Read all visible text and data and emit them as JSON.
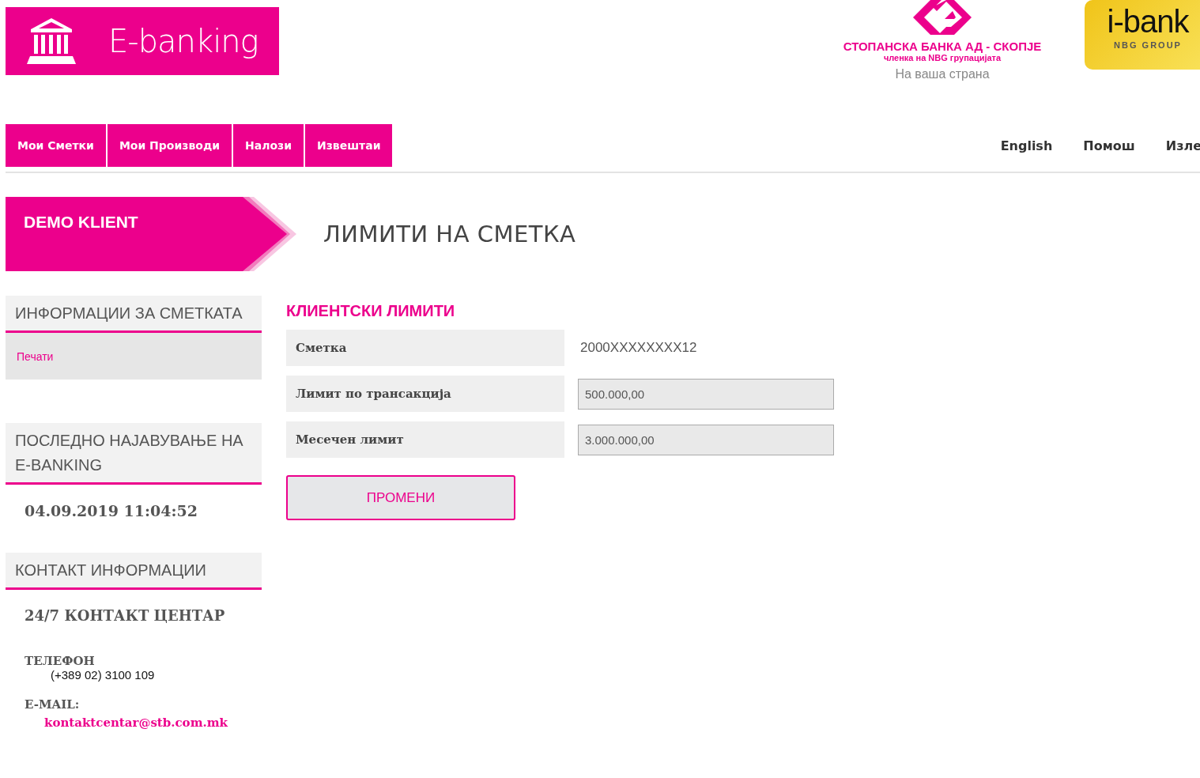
{
  "header": {
    "logo_text": "E-banking",
    "bank_name": "СТОПАНСКА БАНКА АД - СКОПЈЕ",
    "bank_member": "членка на NBG групацијата",
    "bank_slogan": "На ваша страна",
    "ibank_name": "i-bank",
    "ibank_group": "NBG GROUP"
  },
  "nav": [
    "Мои Сметки",
    "Мои Производи",
    "Налози",
    "Извештаи"
  ],
  "top_links": [
    "English",
    "Помош",
    "Изле"
  ],
  "client": "DEMO KLIENT",
  "page_title": "ЛИМИТИ НА СМЕТКА",
  "sidebar": {
    "account_info": {
      "title": "ИНФОРМАЦИИ ЗА СМЕТКАТА",
      "links": [
        "Печати"
      ]
    },
    "last_login": {
      "title": "ПОСЛЕДНО НАЈАВУВАЊЕ НА E-BANKING",
      "value": "04.09.2019 11:04:52"
    },
    "contact": {
      "title": "КОНТАКТ ИНФОРМАЦИИ",
      "center": "24/7 КОНТАКТ ЦЕНТАР",
      "phone_label": "ТЕЛЕФОН",
      "phone": "(+389 02) 3100 109",
      "email_label": "E-MAIL:",
      "email": "kontaktcentar@stb.com.mk"
    }
  },
  "limits": {
    "title": "КЛИЕНТСКИ ЛИМИТИ",
    "rows": [
      {
        "label": "Сметка",
        "kind": "text",
        "value": "2000XXXXXXXX12"
      },
      {
        "label": "Лимит по трансакција",
        "kind": "input",
        "value": "500.000,00"
      },
      {
        "label": "Месечен лимит",
        "kind": "input",
        "value": "3.000.000,00"
      }
    ],
    "button": "ПРОМЕНИ"
  }
}
